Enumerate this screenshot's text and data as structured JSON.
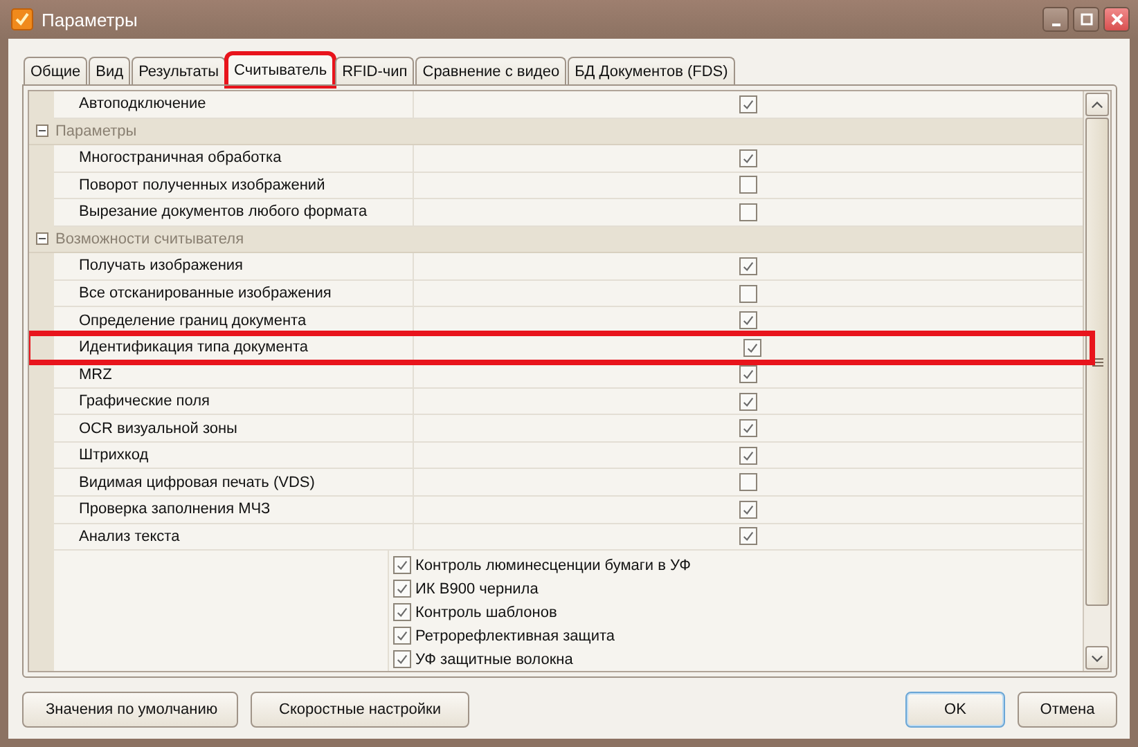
{
  "window": {
    "title": "Параметры"
  },
  "tabs": [
    {
      "label": "Общие",
      "selected": false,
      "highlighted": false
    },
    {
      "label": "Вид",
      "selected": false,
      "highlighted": false
    },
    {
      "label": "Результаты",
      "selected": false,
      "highlighted": false
    },
    {
      "label": "Считыватель",
      "selected": true,
      "highlighted": true
    },
    {
      "label": "RFID-чип",
      "selected": false,
      "highlighted": false
    },
    {
      "label": "Сравнение с видео",
      "selected": false,
      "highlighted": false
    },
    {
      "label": "БД Документов (FDS)",
      "selected": false,
      "highlighted": false
    }
  ],
  "rows": [
    {
      "kind": "option",
      "label": "Автоподключение",
      "checked": true,
      "highlighted": false
    },
    {
      "kind": "group",
      "label": "Параметры",
      "expanded": true,
      "children": [
        {
          "kind": "option",
          "label": "Многостраничная обработка",
          "checked": true,
          "highlighted": false
        },
        {
          "kind": "option",
          "label": "Поворот полученных изображений",
          "checked": false,
          "highlighted": false
        },
        {
          "kind": "option",
          "label": "Вырезание документов любого формата",
          "checked": false,
          "highlighted": false
        }
      ]
    },
    {
      "kind": "group",
      "label": "Возможности считывателя",
      "expanded": true,
      "children": [
        {
          "kind": "option",
          "label": "Получать изображения",
          "checked": true,
          "highlighted": false
        },
        {
          "kind": "option",
          "label": "Все отсканированные изображения",
          "checked": false,
          "highlighted": false
        },
        {
          "kind": "option",
          "label": "Определение границ документа",
          "checked": true,
          "highlighted": false
        },
        {
          "kind": "option",
          "label": "Идентификация типа документа",
          "checked": true,
          "highlighted": true
        },
        {
          "kind": "option",
          "label": "MRZ",
          "checked": true,
          "highlighted": false
        },
        {
          "kind": "option",
          "label": "Графические поля",
          "checked": true,
          "highlighted": false
        },
        {
          "kind": "option",
          "label": "OCR визуальной зоны",
          "checked": true,
          "highlighted": false
        },
        {
          "kind": "option",
          "label": "Штрихкод",
          "checked": true,
          "highlighted": false
        },
        {
          "kind": "option",
          "label": "Видимая цифровая печать (VDS)",
          "checked": false,
          "highlighted": false
        },
        {
          "kind": "option",
          "label": "Проверка заполнения МЧЗ",
          "checked": true,
          "highlighted": false
        },
        {
          "kind": "option",
          "label": "Анализ текста",
          "checked": true,
          "highlighted": false
        }
      ]
    },
    {
      "kind": "checklist",
      "items": [
        {
          "label": "Контроль люминесценции бумаги в УФ",
          "checked": true
        },
        {
          "label": "ИК B900 чернила",
          "checked": true
        },
        {
          "label": "Контроль шаблонов",
          "checked": true
        },
        {
          "label": "Ретрорефлективная защита",
          "checked": true
        },
        {
          "label": "УФ защитные волокна",
          "checked": true
        }
      ]
    }
  ],
  "buttons_left": [
    "Значения по умолчанию",
    "Скоростные настройки"
  ],
  "buttons_right": [
    {
      "label": "OK",
      "default": true
    },
    {
      "label": "Отмена",
      "default": false
    }
  ]
}
